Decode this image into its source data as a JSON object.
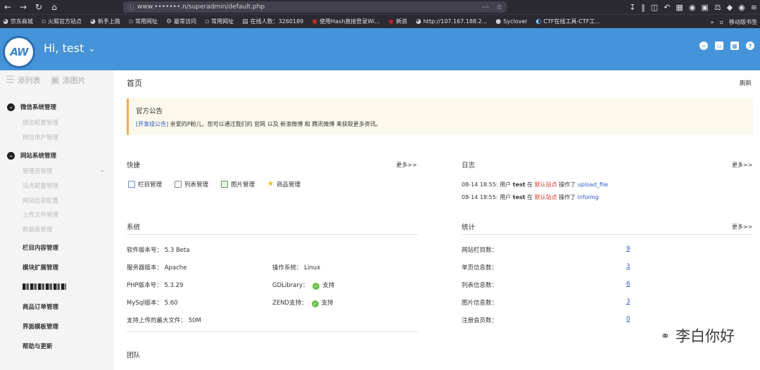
{
  "browser": {
    "url": "www.•••••••.n/superadmin/default.php",
    "bookmarks": [
      "京东商城",
      "火狐官方站点",
      "新手上路",
      "常用网址",
      "最常访问",
      "常用网址",
      "在线人数：3260189",
      "使用Hash直接登录Wi...",
      "新浪",
      "http://107.167.188.2...",
      "Syclover",
      "CTF在线工具-CTF工..."
    ],
    "mobile_bookmarks": "移动版书签"
  },
  "header": {
    "logo_text": "AW",
    "greeting": "Hi, test"
  },
  "sidebar": {
    "top_list": "添列表",
    "top_image": "添图片",
    "groups": [
      {
        "label": "微信系统管理",
        "items": [
          "微信配置管理",
          "微信用户管理"
        ]
      },
      {
        "label": "网站系统管理",
        "items": [
          "管理员管理",
          "站点配置管理",
          "网站信息配置",
          "上传文件管理",
          "数据库管理"
        ]
      }
    ],
    "main_items": [
      "栏目内容管理",
      "模块扩展管理",
      "商品订单管理",
      "界面模板管理",
      "帮助与更新"
    ]
  },
  "main": {
    "title": "首页",
    "refresh": "刷新",
    "notice": {
      "title": "官方公告",
      "tag": "[开发组公告]",
      "text": "亲爱的P粉儿，您可以通过我们的 官网 以及 新浪微博 和 腾讯微博 来获取更多资讯。"
    },
    "quick": {
      "title": "快捷",
      "more": "更多>>",
      "items": [
        "栏目管理",
        "列表管理",
        "图片管理",
        "商品管理"
      ]
    },
    "log": {
      "title": "日志",
      "more": "更多>>",
      "entries": [
        {
          "time": "08-14 18:55:",
          "user_prefix": "用户",
          "user": "test",
          "in": "在",
          "site": "默认站点",
          "action": "操作了",
          "target": "upload_file"
        },
        {
          "time": "08-14 18:55:",
          "user_prefix": "用户",
          "user": "test",
          "in": "在",
          "site": "默认站点",
          "action": "操作了",
          "target": "infoimg"
        }
      ]
    },
    "system": {
      "title": "系统",
      "software_label": "软件版本号：",
      "software_value": "5.3 Beta",
      "server_label": "服务器版本：",
      "server_value": "Apache",
      "os_label": "操作系统：",
      "os_value": "Linux",
      "php_label": "PHP版本号：",
      "php_value": "5.3.29",
      "gd_label": "GDLibrary：",
      "gd_value": "支持",
      "mysql_label": "MySql版本：",
      "mysql_value": "5.60",
      "zend_label": "ZEND支持：",
      "zend_value": "支持",
      "upload_label": "支持上传的最大文件：",
      "upload_value": "50M"
    },
    "stats": {
      "title": "统计",
      "more": "更多>>",
      "rows": [
        {
          "label": "网站栏目数：",
          "value": "9"
        },
        {
          "label": "单页信息数：",
          "value": "3"
        },
        {
          "label": "列表信息数：",
          "value": "6"
        },
        {
          "label": "图片信息数：",
          "value": "3"
        },
        {
          "label": "注册会员数：",
          "value": "0"
        }
      ]
    },
    "team": {
      "title": "团队"
    }
  },
  "watermark": "李白你好"
}
